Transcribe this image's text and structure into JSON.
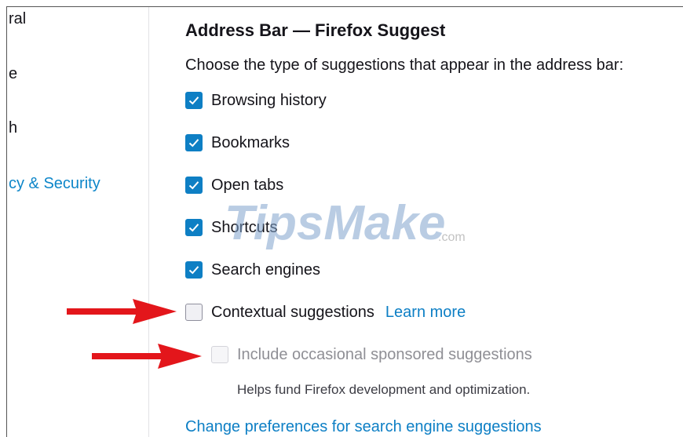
{
  "sidebar": {
    "items": [
      {
        "label": "ral"
      },
      {
        "label": "e"
      },
      {
        "label": "h"
      },
      {
        "label": "cy & Security",
        "active": true
      }
    ]
  },
  "section": {
    "title": "Address Bar — Firefox Suggest",
    "description": "Choose the type of suggestions that appear in the address bar:"
  },
  "options": [
    {
      "label": "Browsing history",
      "state": "checked"
    },
    {
      "label": "Bookmarks",
      "state": "checked"
    },
    {
      "label": "Open tabs",
      "state": "checked"
    },
    {
      "label": "Shortcuts",
      "state": "checked"
    },
    {
      "label": "Search engines",
      "state": "checked"
    },
    {
      "label": "Contextual suggestions",
      "state": "unchecked",
      "link": "Learn more"
    },
    {
      "label": "Include occasional sponsored suggestions",
      "state": "disabled",
      "hint": "Helps fund Firefox development and optimization."
    }
  ],
  "bottom_link": "Change preferences for search engine suggestions",
  "watermark": {
    "brand": "TipsMake",
    "suffix": ".com"
  },
  "colors": {
    "accent": "#0e7fc4",
    "link": "#0d7fc5",
    "arrow": "#e3161b",
    "watermark": "#7fa3cc"
  },
  "icons": {
    "checkbox_check": "checkmark-icon",
    "annotation": "red-arrow-icon"
  }
}
